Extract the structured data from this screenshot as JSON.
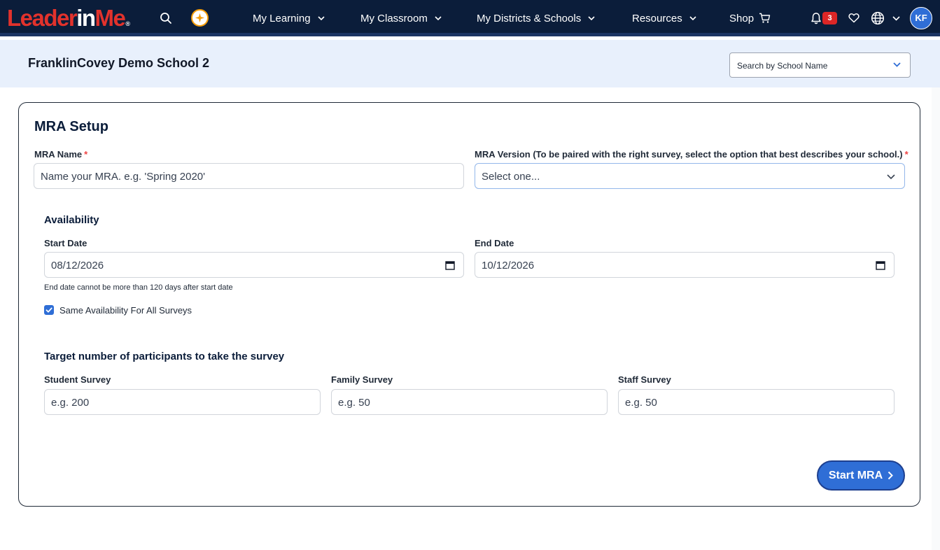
{
  "nav": {
    "logo": {
      "part1": "Leader",
      "part2": "in",
      "part3": "Me",
      "reg": "®"
    },
    "items": [
      {
        "label": "My Learning"
      },
      {
        "label": "My Classroom"
      },
      {
        "label": "My Districts & Schools"
      },
      {
        "label": "Resources"
      },
      {
        "label": "Shop"
      }
    ],
    "notification_count": "3",
    "avatar_initials": "KF",
    "icons": [
      "search-icon",
      "sparkle-icon",
      "chevron-down-icon",
      "cart-icon",
      "bell-icon",
      "heart-icon",
      "globe-icon"
    ]
  },
  "school_bar": {
    "school_name": "FranklinCovey Demo School 2",
    "search_placeholder": "Search by School Name"
  },
  "form": {
    "title": "MRA Setup",
    "mra_name": {
      "label": "MRA Name",
      "required": "*",
      "placeholder": "Name your MRA. e.g. 'Spring 2020'"
    },
    "mra_version": {
      "label": "MRA Version (To be paired with the right survey, select the option that best describes your school.)",
      "required": "*",
      "selected": "Select one..."
    },
    "availability": {
      "heading": "Availability",
      "start_date": {
        "label": "Start Date",
        "value": "08/12/2026"
      },
      "end_date": {
        "label": "End Date",
        "value": "10/12/2026"
      },
      "hint": "End date cannot be more than 120 days after start date",
      "same_availability": {
        "label": "Same Availability For All Surveys",
        "checked": true
      }
    },
    "participants": {
      "heading": "Target number of participants to take the survey",
      "student": {
        "label": "Student Survey",
        "placeholder": "e.g. 200"
      },
      "family": {
        "label": "Family Survey",
        "placeholder": "e.g. 50"
      },
      "staff": {
        "label": "Staff Survey",
        "placeholder": "e.g. 50"
      }
    },
    "submit_label": "Start MRA"
  },
  "colors": {
    "nav_bg": "#0b1d3a",
    "accent": "#2f6ed6",
    "brand_red": "#e2322c",
    "school_bar_bg": "#e8f0fc"
  }
}
